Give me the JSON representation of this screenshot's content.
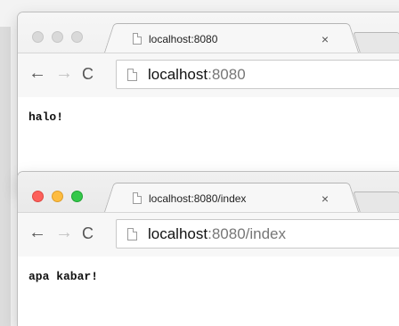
{
  "windows": [
    {
      "state": "inactive",
      "tab_title": "localhost:8080",
      "tab_close": "×",
      "url_host": "localhost",
      "url_rest": ":8080",
      "page_text": "halo!"
    },
    {
      "state": "active",
      "tab_title": "localhost:8080/index",
      "tab_close": "×",
      "url_host": "localhost",
      "url_rest": ":8080/index",
      "page_text": "apa kabar!"
    }
  ],
  "nav": {
    "back": "←",
    "forward": "→",
    "reload": "C"
  },
  "colors": {
    "close_light": "#fc605b",
    "minimize_light": "#fdbc40",
    "zoom_light": "#34c84a",
    "inactive_light": "#d9d9d9"
  }
}
